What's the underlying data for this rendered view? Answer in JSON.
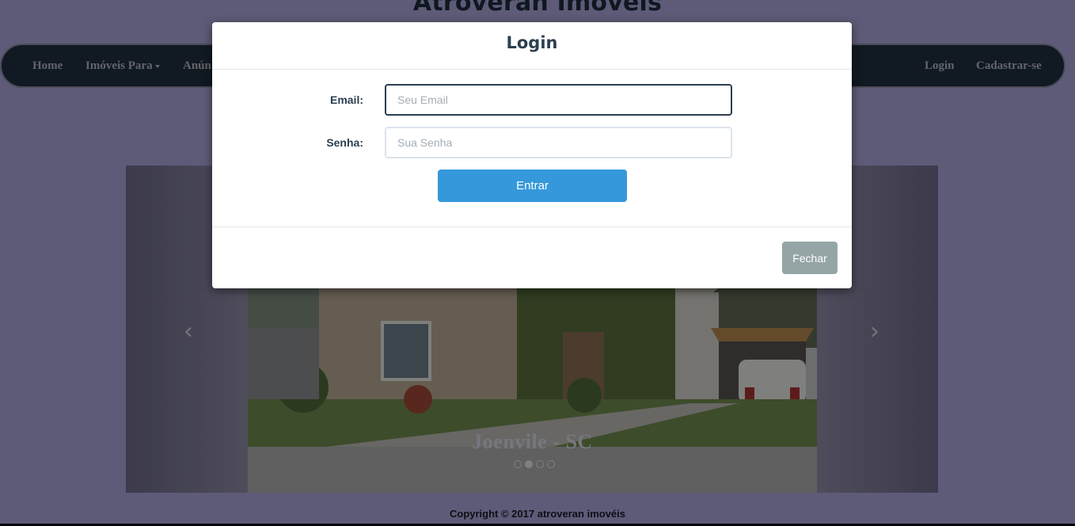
{
  "site": {
    "title": "Atroveran Imovéis"
  },
  "nav": {
    "left_items": [
      {
        "label": "Home"
      },
      {
        "label": "Imóveis Para"
      },
      {
        "label": "Anún"
      }
    ],
    "right_items": [
      {
        "label": "Login"
      },
      {
        "label": "Cadastrar-se"
      }
    ]
  },
  "carousel": {
    "caption": "Joenvile - SC",
    "prev_icon": "chevron-left-icon",
    "next_icon": "chevron-right-icon",
    "slide_count": 4,
    "active_slide_index": 1
  },
  "footer": {
    "text": "Copyright © 2017 atroveran imovéis"
  },
  "modal": {
    "title": "Login",
    "email_label": "Email:",
    "email_placeholder": "Seu Email",
    "email_value": "",
    "password_label": "Senha:",
    "password_placeholder": "Sua Senha",
    "password_value": "",
    "submit_label": "Entrar",
    "close_label": "Fechar"
  },
  "colors": {
    "page_background": "#a9a6d9",
    "navbar": "#1f2e3f",
    "primary_button": "#3498db",
    "close_button": "#95a5a6",
    "heading_text": "#2c3e50"
  }
}
